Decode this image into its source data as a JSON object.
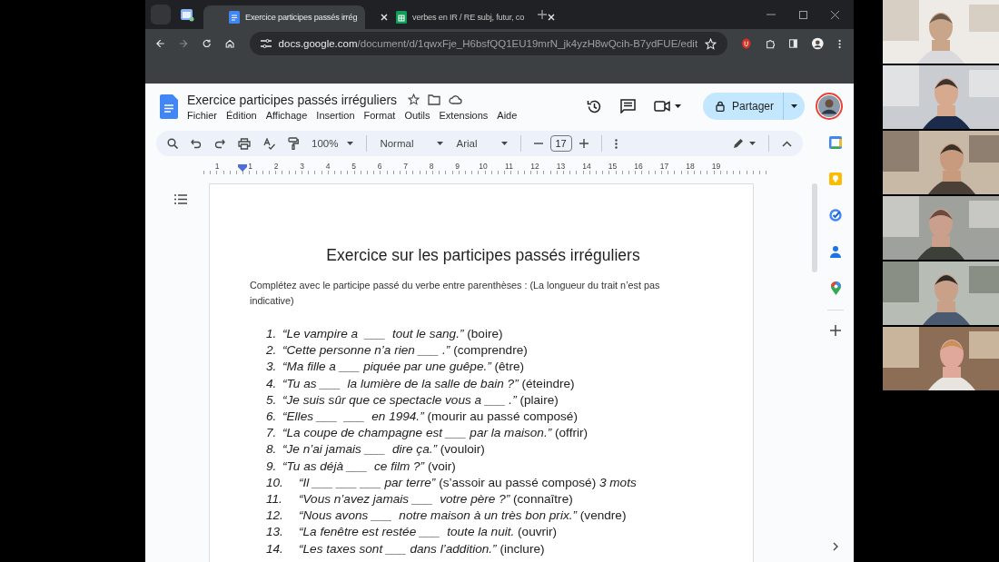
{
  "browser": {
    "tabs": [
      {
        "title": "Exercice participes passés irrég",
        "selected": true,
        "kind": "docs"
      },
      {
        "title": "verbes en IR / RE subj, futur, co",
        "selected": false,
        "kind": "sheets"
      }
    ],
    "url_host": "docs.google.com",
    "url_path": "/document/d/1qwxFje_H6bsfQQ1EU19mrN_jk4yzH8wQcih-B7ydFUE/edit"
  },
  "docs": {
    "title": "Exercice participes passés irréguliers",
    "menu": [
      "Fichier",
      "Édition",
      "Affichage",
      "Insertion",
      "Format",
      "Outils",
      "Extensions",
      "Aide"
    ],
    "share_label": "Partager",
    "toolbar": {
      "zoom": "100%",
      "style": "Normal",
      "font": "Arial",
      "font_size": "17"
    },
    "ruler": [
      "1",
      "1",
      "2",
      "3",
      "4",
      "5",
      "6",
      "7",
      "8",
      "9",
      "10",
      "11",
      "12",
      "13",
      "14",
      "15",
      "16",
      "17",
      "18",
      "19"
    ]
  },
  "document": {
    "heading": "Exercice sur les participes passés irréguliers",
    "intro": "Complétez avec le participe passé du verbe entre parenthèses : (La longueur du trait n’est pas indicative)",
    "items": [
      {
        "number": "1.",
        "text": "*“Le vampire a  ___  tout le sang.”* (boire)"
      },
      {
        "number": "2.",
        "text": "*“Cette personne n’a rien ___ .”* (comprendre)"
      },
      {
        "number": "3.",
        "text": "*“Ma fille a ___ piquée par une guêpe.”* (être)"
      },
      {
        "number": "4.",
        "text": "*“Tu as ___  la lumière de la salle de bain ?”* (éteindre)"
      },
      {
        "number": "5.",
        "text": "*“Je suis sûr que ce spectacle vous a ___ .”* (plaire)"
      },
      {
        "number": "6.",
        "text": "*“Elles ___  ___  en 1994.”* (mourir au passé composé)"
      },
      {
        "number": "7.",
        "text": "*“La coupe de champagne est ___ par la maison.”* (offrir)"
      },
      {
        "number": "8.",
        "text": "*“Je n’ai jamais ___  dire ça.”* (vouloir)"
      },
      {
        "number": "9.",
        "text": "*“Tu as déjà ___  ce film ?”* (voir)"
      },
      {
        "number": "10.",
        "text": "*“Il ___ ___ ___ par terre”* (s’assoir au passé composé) *3 mots*"
      },
      {
        "number": "11.",
        "text": "*“Vous n’avez jamais ___  votre père ?”* (connaître)"
      },
      {
        "number": "12.",
        "text": "*“Nous avons ___  notre maison à un très bon prix.”* (vendre)"
      },
      {
        "number": "13.",
        "text": "*“La fenêtre est restée ___  toute la nuit.* (ouvrir)"
      },
      {
        "number": "14.",
        "text": "*“Les taxes sont ___ dans l’addition.”* (inclure)"
      }
    ]
  }
}
